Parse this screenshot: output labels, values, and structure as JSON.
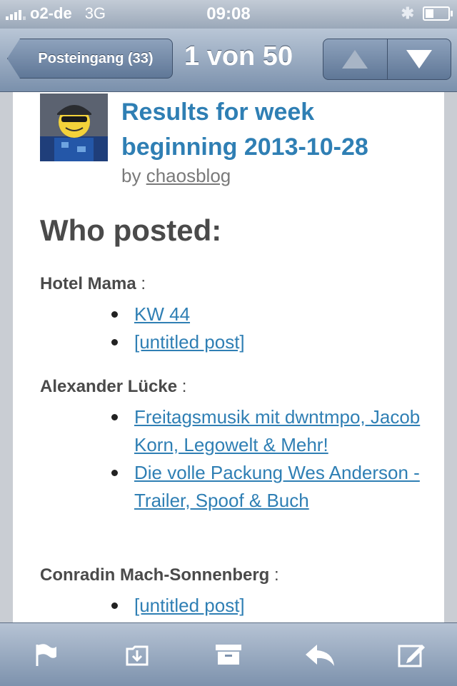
{
  "status_bar": {
    "carrier": "o2-de",
    "network": "3G",
    "time": "09:08",
    "battery_level": 0.35
  },
  "nav": {
    "back_label": "Posteingang (33)",
    "counter": "1 von 50",
    "prev_icon": "arrow-up-icon",
    "next_icon": "arrow-down-icon"
  },
  "post": {
    "title": "Results for week beginning 2013-10-28",
    "by_prefix": "by",
    "author": "chaosblog",
    "section_heading": "Who posted:"
  },
  "authors": [
    {
      "name": "Hotel Mama",
      "suffix": " :",
      "links": [
        "KW 44",
        "[untitled post]"
      ]
    },
    {
      "name": "Alexander Lücke",
      "suffix": " :",
      "links": [
        "Freitagsmusik mit dwntmpo, Jacob Korn, Legowelt & Mehr!",
        "Die volle Packung Wes Anderson - Trailer, Spoof & Buch"
      ]
    },
    {
      "name": "Conradin Mach-Sonnenberg",
      "suffix": " :",
      "links": [
        "[untitled post]"
      ]
    }
  ],
  "toolbar": {
    "icons": [
      "flag-icon",
      "move-to-folder-icon",
      "archive-icon",
      "reply-icon",
      "compose-icon"
    ]
  },
  "colors": {
    "link": "#2f7fb4",
    "text": "#4a4a4a",
    "bar": "#7d92ad"
  }
}
